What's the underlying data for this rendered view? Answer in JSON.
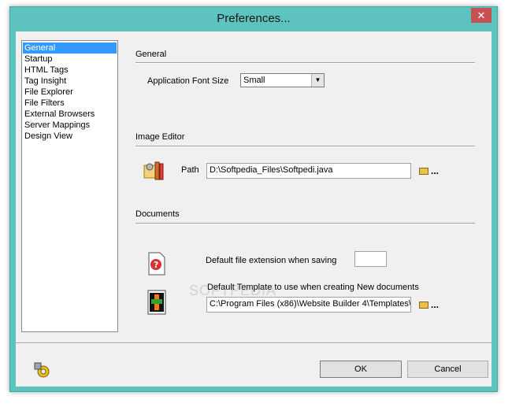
{
  "window": {
    "title": "Preferences..."
  },
  "categories": [
    {
      "label": "General",
      "selected": true
    },
    {
      "label": "Startup"
    },
    {
      "label": "HTML Tags"
    },
    {
      "label": "Tag Insight"
    },
    {
      "label": "File Explorer"
    },
    {
      "label": "File Filters"
    },
    {
      "label": "External Browsers"
    },
    {
      "label": "Server Mappings"
    },
    {
      "label": "Design View"
    }
  ],
  "general": {
    "title": "General",
    "font_size_label": "Application Font Size",
    "font_size_value": "Small"
  },
  "image_editor": {
    "title": "Image Editor",
    "path_label": "Path",
    "path_value": "D:\\Softpedia_Files\\Softpedi.java",
    "browse_dots": "..."
  },
  "documents": {
    "title": "Documents",
    "ext_label": "Default file extension when saving",
    "ext_value": "",
    "template_label": "Default Template to use when creating New documents",
    "template_value": "C:\\Program Files (x86)\\Website Builder 4\\Templates\\D",
    "browse_dots": "..."
  },
  "buttons": {
    "ok": "OK",
    "cancel": "Cancel"
  },
  "watermark": "SOFTPEDIA",
  "colors": {
    "title_bar": "#5ec2be",
    "close": "#c75050",
    "selection": "#3399ff"
  },
  "icons": [
    "close-icon",
    "image-editor-icon",
    "file-extension-icon",
    "template-icon",
    "folder-icon",
    "tools-icon",
    "select-arrow-icon"
  ]
}
